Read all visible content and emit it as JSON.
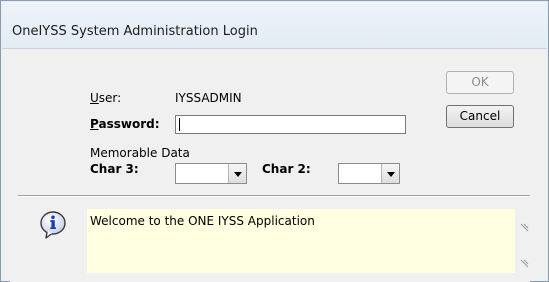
{
  "window": {
    "title": "OneIYSS System Administration Login"
  },
  "form": {
    "user_label": "User:",
    "user_value": "IYSSADMIN",
    "password_label": "Password:",
    "password_value": "",
    "memorable_label": "Memorable Data",
    "char3_label": "Char 3:",
    "char3_value": "",
    "char2_label": "Char 2:",
    "char2_value": ""
  },
  "buttons": {
    "ok_label": "OK",
    "cancel_label": "Cancel"
  },
  "message": {
    "icon": "info-icon",
    "text": "Welcome to the ONE IYSS Application"
  },
  "colors": {
    "message_bg": "#ffffe1",
    "info_icon": "#1a3fb8"
  }
}
